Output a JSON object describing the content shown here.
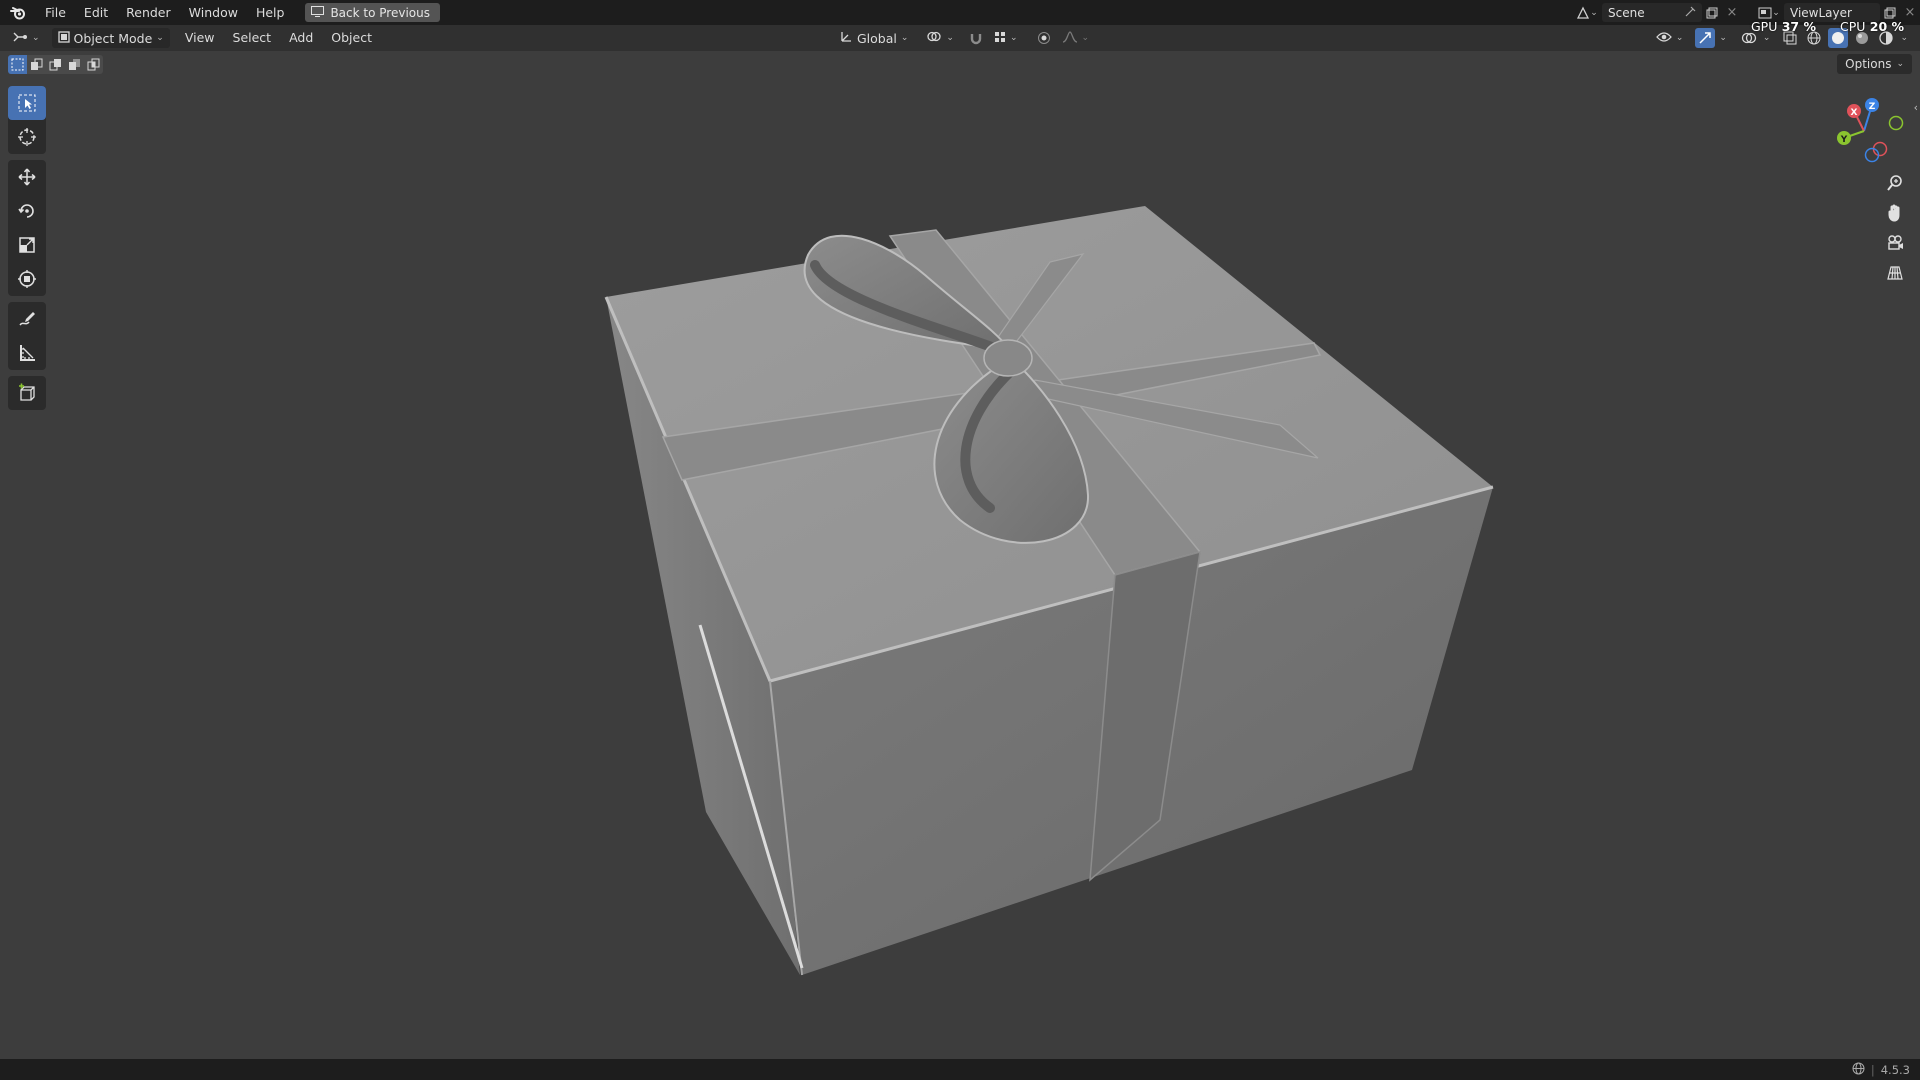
{
  "topbar": {
    "menus": [
      "File",
      "Edit",
      "Render",
      "Window",
      "Help"
    ],
    "back_label": "Back to Previous",
    "scene_name": "Scene",
    "view_layer": "ViewLayer"
  },
  "stats": {
    "gpu_label": "GPU",
    "gpu_value": "37 %",
    "cpu_label": "CPU",
    "cpu_value": "20 %"
  },
  "header": {
    "mode": "Object Mode",
    "menus": [
      "View",
      "Select",
      "Add",
      "Object"
    ],
    "orientation": "Global"
  },
  "options_label": "Options",
  "gizmo": {
    "x": "X",
    "y": "Y",
    "z": "Z"
  },
  "status": {
    "version": "4.5.3"
  },
  "colors": {
    "accent": "#4772b3",
    "axis_x": "#e0525a",
    "axis_y": "#8bc52f",
    "axis_z": "#3b83e6"
  }
}
